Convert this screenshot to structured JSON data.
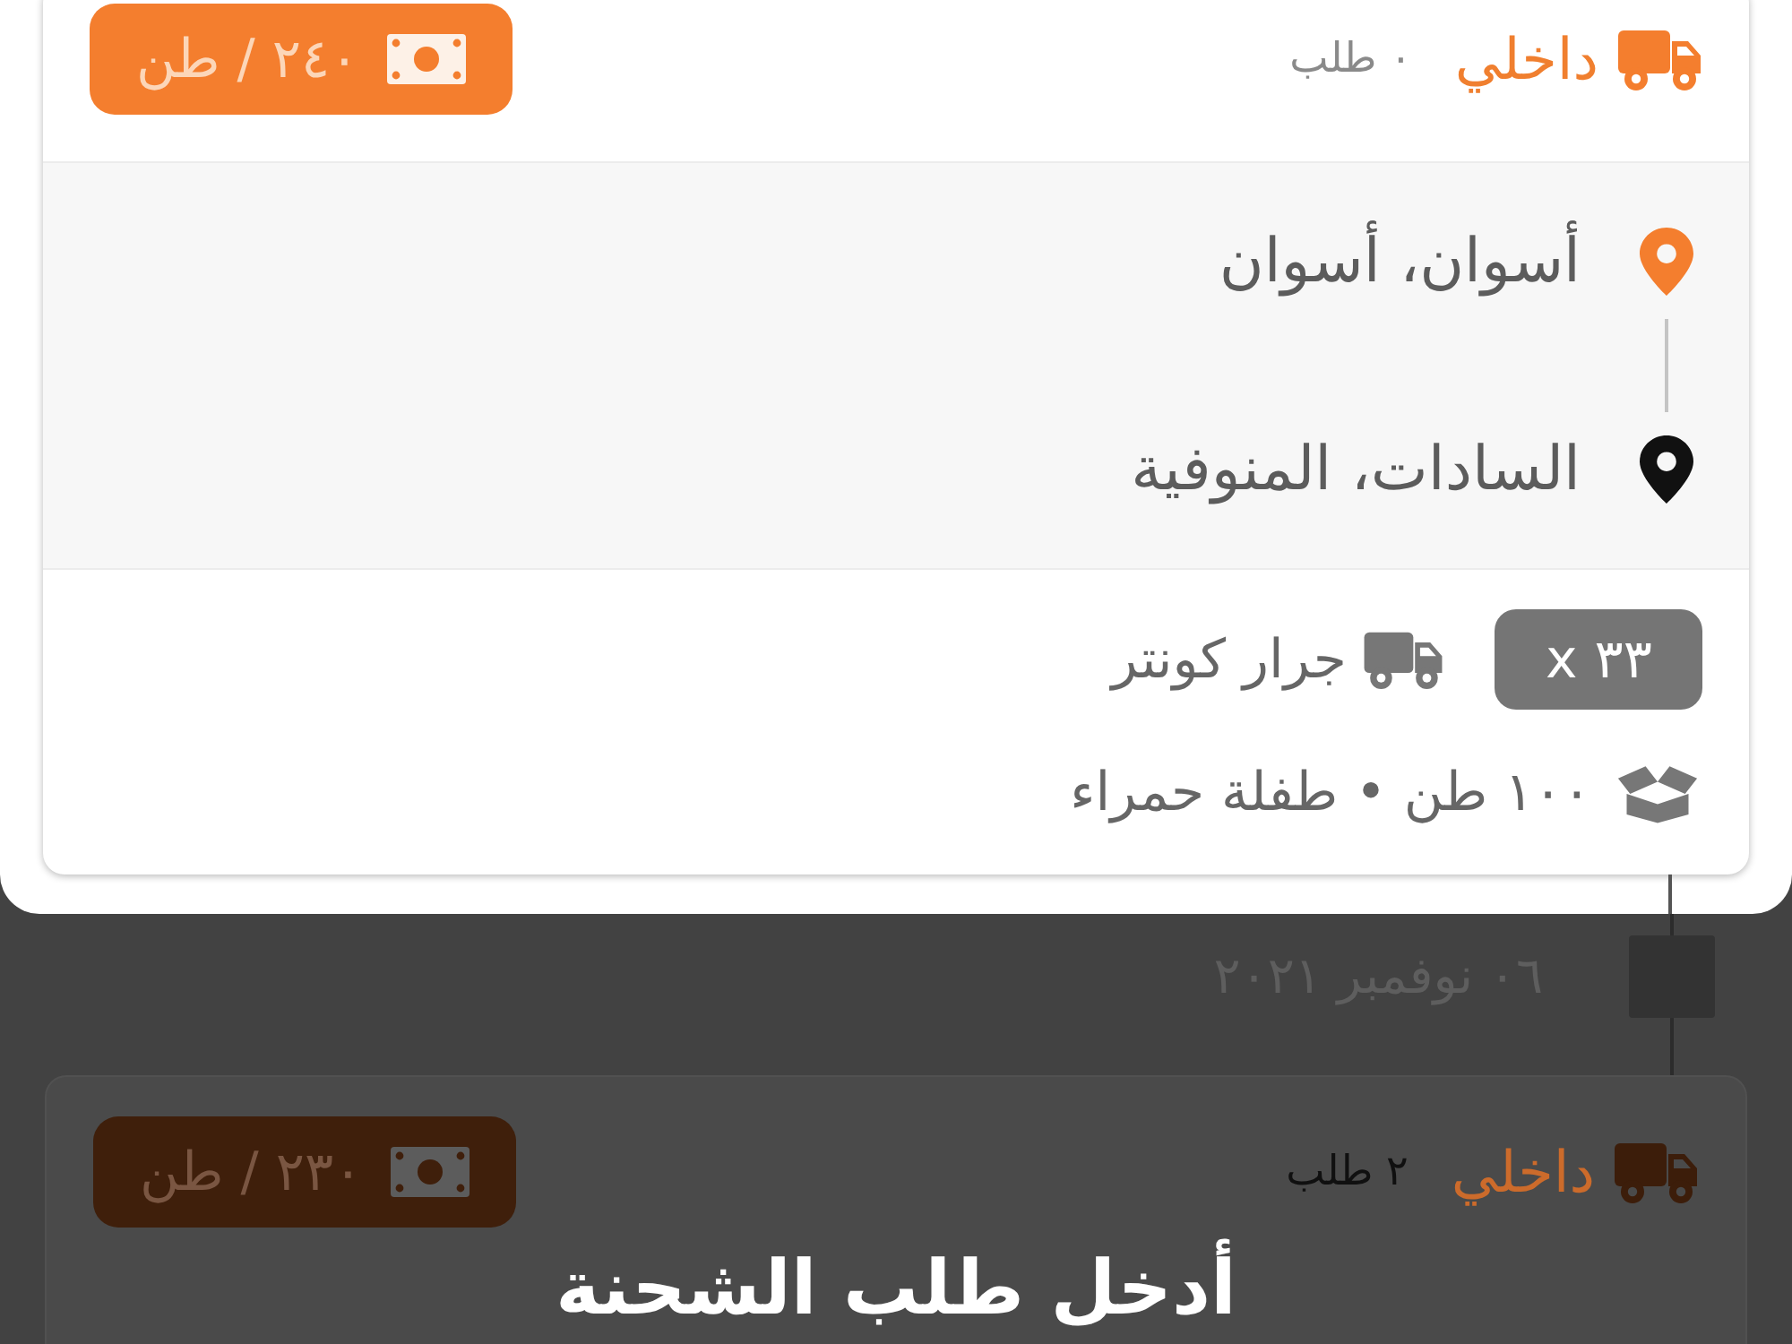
{
  "timeline": [
    {
      "kind": "order",
      "highlighted": true,
      "type": "داخلي",
      "count": "٠ طلب",
      "price": "٢٤٠ / طن",
      "origin": "أسوان، أسوان",
      "destination": "السادات، المنوفية",
      "truck_count": "x ٣٣",
      "truck_type": "جرار كونتر",
      "cargo": "١٠٠ طن • طفلة حمراء"
    },
    {
      "kind": "date",
      "label": "٠٦ نوفمبر ٢٠٢١"
    },
    {
      "kind": "order",
      "highlighted": false,
      "type": "داخلي",
      "count": "٢ طلب",
      "price": "٢٣٠ / طن"
    }
  ],
  "tutorial": {
    "text": "أدخل طلب الشحنة"
  }
}
